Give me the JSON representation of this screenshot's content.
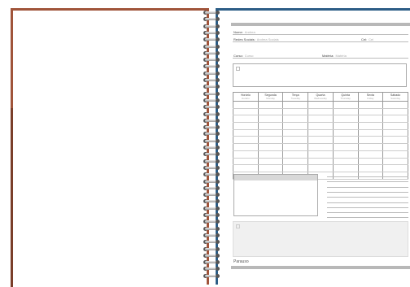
{
  "labels": {
    "nome": {
      "label": "Nome:",
      "placeholder": "Andrea"
    },
    "redes": {
      "label": "Redes Sociais:",
      "placeholder": "Andrea Sociais"
    },
    "cel": {
      "label": "Cel:",
      "placeholder": "Cel"
    },
    "curso": {
      "label": "Curso:",
      "placeholder": "Curso"
    },
    "materia": {
      "label": "Matéria:",
      "placeholder": "Matéria"
    }
  },
  "schedule": {
    "days": [
      {
        "name": "Horário",
        "sub": "Horário"
      },
      {
        "name": "Segunda",
        "sub": "Monday"
      },
      {
        "name": "Terça",
        "sub": "Tuesday"
      },
      {
        "name": "Quarta",
        "sub": "Wednesday"
      },
      {
        "name": "Quinta",
        "sub": "Thursday"
      },
      {
        "name": "Sexta",
        "sub": "Friday"
      },
      {
        "name": "Sábado",
        "sub": "Saturday"
      }
    ],
    "row_count": 11
  },
  "footer": {
    "label": "Parauso"
  },
  "colors": {
    "left_cover": "#a0543a",
    "right_cover": "#2c5d86",
    "header_bar": "#b8b8b8"
  }
}
